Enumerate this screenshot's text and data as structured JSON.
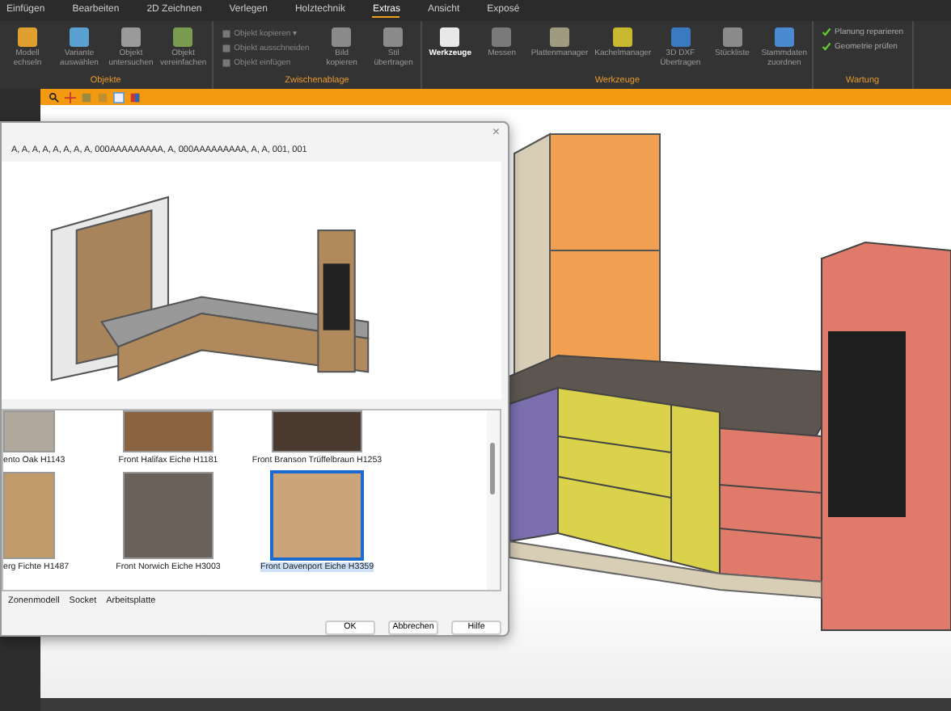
{
  "ribbon": {
    "tabs": [
      {
        "label": "Einfügen",
        "selected": false
      },
      {
        "label": "Bearbeiten",
        "selected": false
      },
      {
        "label": "2D Zeichnen",
        "selected": false
      },
      {
        "label": "Verlegen",
        "selected": false
      },
      {
        "label": "Holztechnik",
        "selected": false
      },
      {
        "label": "Extras",
        "selected": true
      },
      {
        "label": "Ansicht",
        "selected": false
      },
      {
        "label": "Exposé",
        "selected": false
      }
    ],
    "groups": [
      {
        "name": "Objekte",
        "buttons": [
          {
            "label": "Modell echseln",
            "selected": false,
            "color": "#e0a030"
          },
          {
            "label": "Variante auswählen",
            "selected": false,
            "color": "#5aa0d0"
          },
          {
            "label": "Objekt untersuchen",
            "selected": false,
            "color": "#9a9a9a"
          },
          {
            "label": "Objekt vereinfachen",
            "selected": false,
            "color": "#7a9a50"
          }
        ]
      },
      {
        "name": "Zwischenablage",
        "small": [
          {
            "label": "Objekt kopieren ▾"
          },
          {
            "label": "Objekt ausschneiden"
          },
          {
            "label": "Objekt einfügen"
          }
        ],
        "buttons": [
          {
            "label": "Bild kopieren",
            "selected": false,
            "color": "#8a8a8a"
          },
          {
            "label": "Stil übertragen",
            "selected": false,
            "color": "#8a8a8a"
          }
        ]
      },
      {
        "name": "Werkzeuge",
        "buttons": [
          {
            "label": "Werkzeuge",
            "selected": true,
            "color": "#e8e8e8"
          },
          {
            "label": "Messen",
            "selected": false,
            "color": "#7a7a7a"
          },
          {
            "label": "Plattenmanager",
            "selected": false,
            "color": "#a09a80"
          },
          {
            "label": "Kachelmanager",
            "selected": false,
            "color": "#c8b830"
          },
          {
            "label": "3D DXF Übertragen",
            "selected": false,
            "color": "#3a7ac0"
          },
          {
            "label": "Stückliste",
            "selected": false,
            "color": "#8a8a8a"
          },
          {
            "label": "Stammdaten zuordnen",
            "selected": false,
            "color": "#4a8ad0"
          }
        ]
      },
      {
        "name": "Wartung",
        "small": [
          {
            "label": "Planung reparieren"
          },
          {
            "label": "Geometrie prüfen"
          }
        ]
      }
    ]
  },
  "dialog": {
    "close": "×",
    "codes": "A, A, A, A, A, A, A, A, 000AAAAAAAAA, A, 000AAAAAAAAA, A, A, 001, 001",
    "swatches": [
      {
        "label": "ento Oak H1143",
        "color": "#b0a89c",
        "selected": false
      },
      {
        "label": "Front Halifax Eiche H1181",
        "color": "#8a6440",
        "selected": false
      },
      {
        "label": "Front Branson Trüffelbraun H1253",
        "color": "#4a3a30",
        "selected": false
      },
      {
        "label": "erg Fichte H1487",
        "color": "#c09a68",
        "selected": false
      },
      {
        "label": "Front Norwich Eiche H3003",
        "color": "#6a625a",
        "selected": false
      },
      {
        "label": "Front Davenport Eiche H3359",
        "color": "#cca47a",
        "selected": true
      }
    ],
    "tabs": [
      {
        "label": "Zonenmodell",
        "selected": false
      },
      {
        "label": "Socket",
        "selected": false
      },
      {
        "label": "Arbeitsplatte",
        "selected": false
      }
    ],
    "buttons": [
      "OK",
      "Abbrechen",
      "Hilfe"
    ]
  }
}
